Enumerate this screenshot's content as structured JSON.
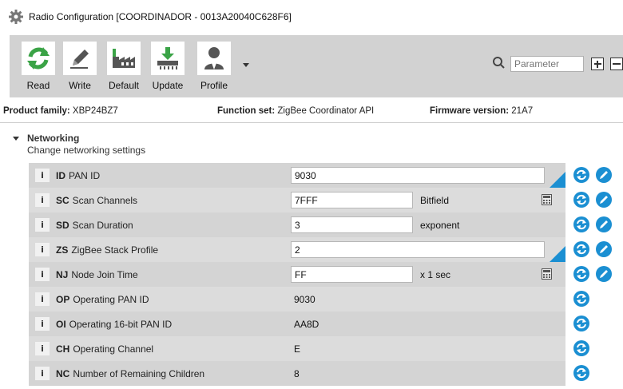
{
  "window": {
    "title": "Radio Configuration [COORDINADOR - 0013A20040C628F6]"
  },
  "toolbar": {
    "read_label": "Read",
    "write_label": "Write",
    "default_label": "Default",
    "update_label": "Update",
    "profile_label": "Profile",
    "search_placeholder": "Parameter"
  },
  "info": {
    "product_family_label": "Product family:",
    "product_family_value": "XBP24BZ7",
    "function_set_label": "Function set:",
    "function_set_value": "ZigBee Coordinator API",
    "firmware_label": "Firmware version:",
    "firmware_value": "21A7"
  },
  "section": {
    "title": "Networking",
    "subtitle": "Change networking settings"
  },
  "rows": [
    {
      "code": "ID",
      "name": "PAN ID",
      "value": "9030",
      "unit": "",
      "editable": true
    },
    {
      "code": "SC",
      "name": "Scan Channels",
      "value": "7FFF",
      "unit": "Bitfield",
      "editable": true
    },
    {
      "code": "SD",
      "name": "Scan Duration",
      "value": "3",
      "unit": "exponent",
      "editable": true
    },
    {
      "code": "ZS",
      "name": "ZigBee Stack Profile",
      "value": "2",
      "unit": "",
      "editable": true
    },
    {
      "code": "NJ",
      "name": "Node Join Time",
      "value": "FF",
      "unit": "x 1 sec",
      "editable": true
    },
    {
      "code": "OP",
      "name": "Operating PAN ID",
      "value": "9030",
      "unit": "",
      "editable": false
    },
    {
      "code": "OI",
      "name": "Operating 16-bit PAN ID",
      "value": "AA8D",
      "unit": "",
      "editable": false
    },
    {
      "code": "CH",
      "name": "Operating Channel",
      "value": "E",
      "unit": "",
      "editable": false
    },
    {
      "code": "NC",
      "name": "Number of Remaining Children",
      "value": "8",
      "unit": "",
      "editable": false
    }
  ],
  "colors": {
    "accent": "#1b8fd2",
    "green": "#3aa346",
    "toolbar_bg": "#d2d2d2",
    "row_bg": "#d4d4d4"
  }
}
